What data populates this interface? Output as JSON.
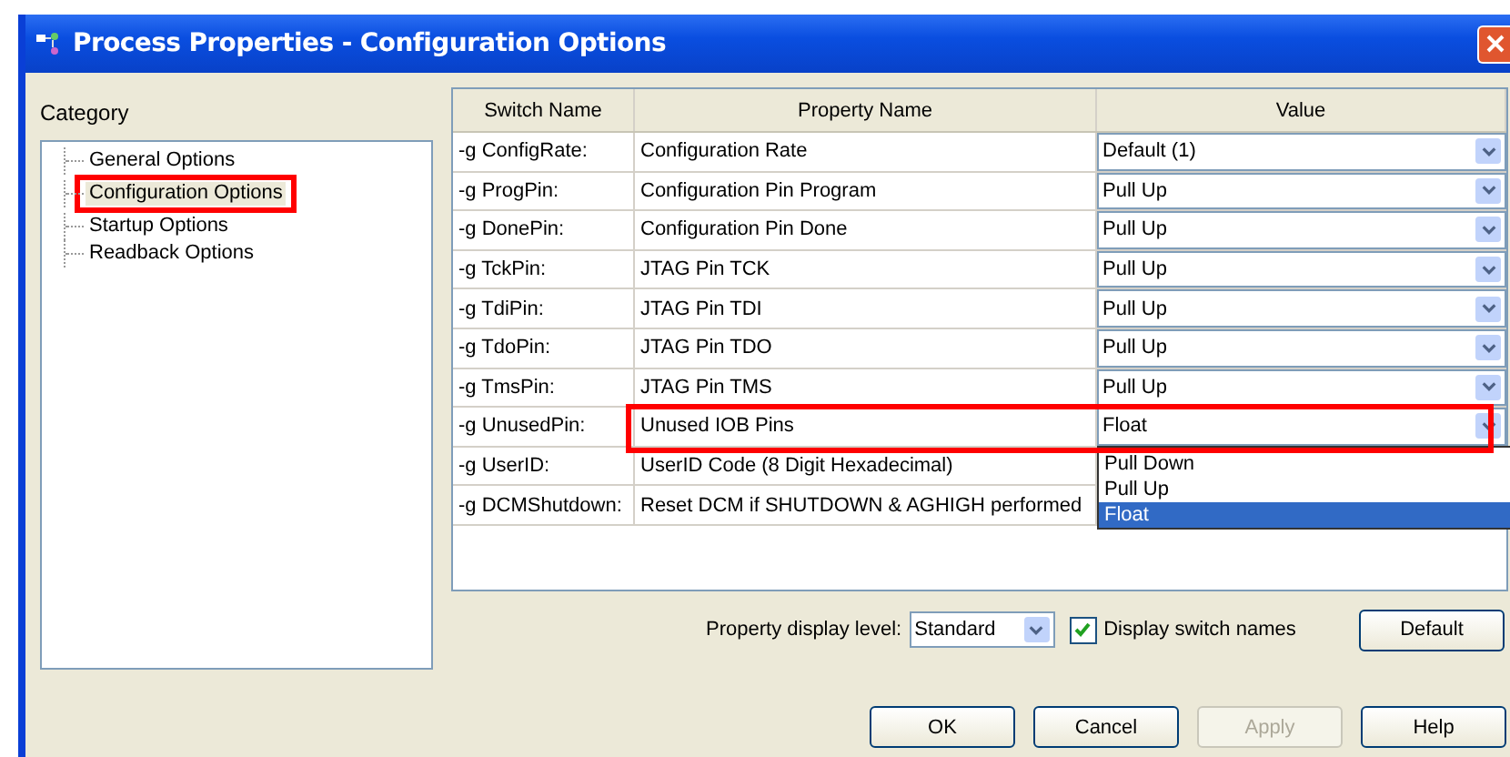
{
  "window": {
    "title": "Process Properties - Configuration Options"
  },
  "category": {
    "label": "Category",
    "items": [
      {
        "label": "General Options",
        "selected": false,
        "highlighted": false
      },
      {
        "label": "Configuration Options",
        "selected": true,
        "highlighted": true
      },
      {
        "label": "Startup Options",
        "selected": false,
        "highlighted": false
      },
      {
        "label": "Readback Options",
        "selected": false,
        "highlighted": false
      }
    ]
  },
  "table": {
    "columns": [
      "Switch Name",
      "Property Name",
      "Value"
    ],
    "rows": [
      {
        "switch": "-g ConfigRate:",
        "property": "Configuration Rate",
        "value": "Default (1)",
        "highlighted": false
      },
      {
        "switch": "-g ProgPin:",
        "property": "Configuration Pin Program",
        "value": "Pull Up",
        "highlighted": false
      },
      {
        "switch": "-g DonePin:",
        "property": "Configuration Pin Done",
        "value": "Pull Up",
        "highlighted": false
      },
      {
        "switch": "-g TckPin:",
        "property": "JTAG Pin TCK",
        "value": "Pull Up",
        "highlighted": false
      },
      {
        "switch": "-g TdiPin:",
        "property": "JTAG Pin TDI",
        "value": "Pull Up",
        "highlighted": false
      },
      {
        "switch": "-g TdoPin:",
        "property": "JTAG Pin TDO",
        "value": "Pull Up",
        "highlighted": false
      },
      {
        "switch": "-g TmsPin:",
        "property": "JTAG Pin TMS",
        "value": "Pull Up",
        "highlighted": false
      },
      {
        "switch": "-g UnusedPin:",
        "property": "Unused IOB Pins",
        "value": "Float",
        "highlighted": true,
        "options": [
          {
            "label": "Pull Down",
            "selected": false
          },
          {
            "label": "Pull Up",
            "selected": false
          },
          {
            "label": "Float",
            "selected": true
          }
        ]
      },
      {
        "switch": "-g UserID:",
        "property": "UserID Code (8 Digit Hexadecimal)",
        "highlighted": false
      },
      {
        "switch": "-g DCMShutdown:",
        "property": "Reset DCM if SHUTDOWN & AGHIGH performed",
        "highlighted": false
      }
    ]
  },
  "display_level": {
    "label": "Property display level:",
    "value": "Standard"
  },
  "display_switch_names": {
    "label": "Display switch names",
    "checked": true
  },
  "buttons": [
    {
      "label": "Default",
      "disabled": false,
      "kind": "side"
    },
    {
      "label": "OK",
      "disabled": false,
      "kind": "main"
    },
    {
      "label": "Cancel",
      "disabled": false,
      "kind": "main"
    },
    {
      "label": "Apply",
      "disabled": true,
      "kind": "main"
    },
    {
      "label": "Help",
      "disabled": false,
      "kind": "main"
    }
  ]
}
